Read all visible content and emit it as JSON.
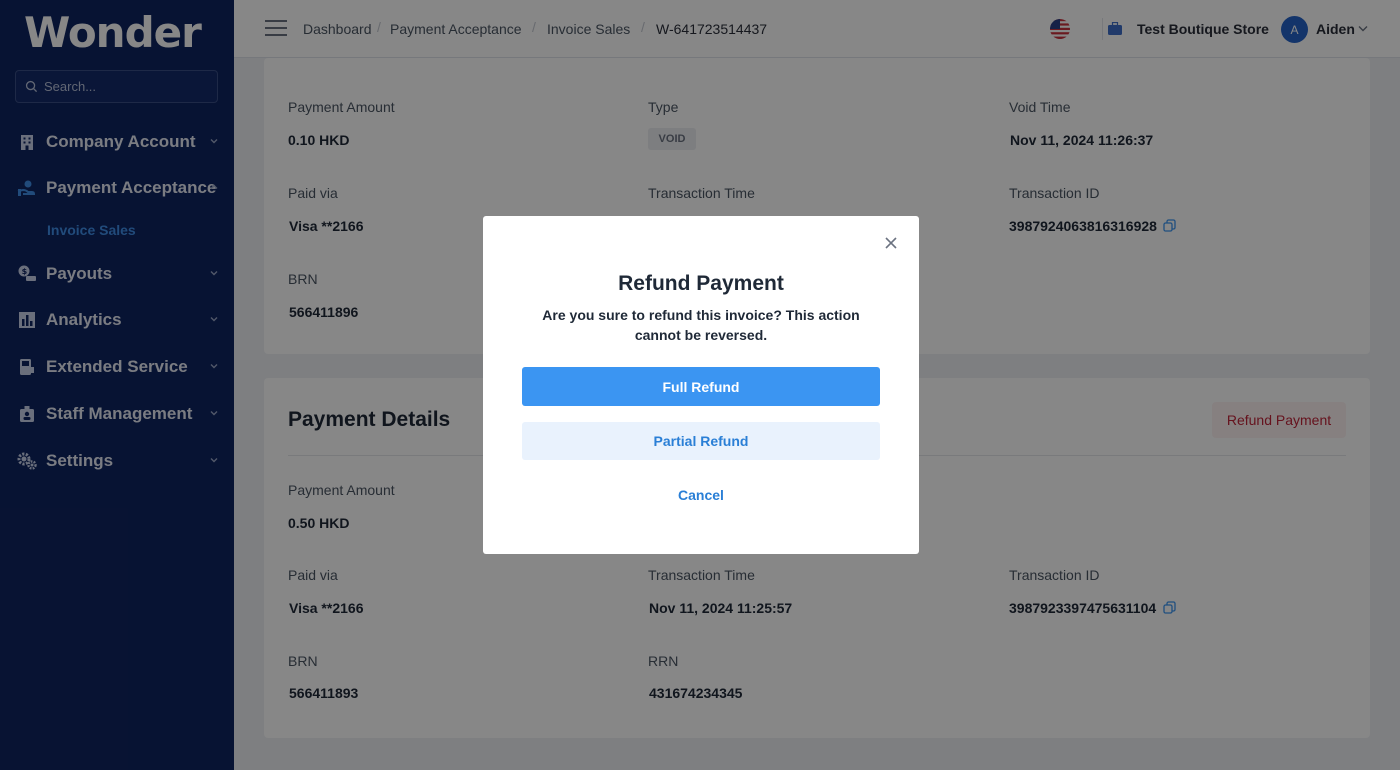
{
  "app": {
    "logo": "Wonder"
  },
  "search": {
    "placeholder": "Search..."
  },
  "sidebar": {
    "items": [
      {
        "label": "Company Account",
        "icon": "building-icon"
      },
      {
        "label": "Payment Acceptance",
        "icon": "hand-payment-icon"
      },
      {
        "label": "Payouts",
        "icon": "coins-icon"
      },
      {
        "label": "Analytics",
        "icon": "bar-chart-icon"
      },
      {
        "label": "Extended Service",
        "icon": "pos-terminal-icon"
      },
      {
        "label": "Staff Management",
        "icon": "staff-badge-icon"
      },
      {
        "label": "Settings",
        "icon": "gears-icon"
      }
    ],
    "sub_item": "Invoice Sales",
    "active_color": "#3f8ee8"
  },
  "header": {
    "breadcrumbs": [
      "Dashboard",
      "Payment Acceptance",
      "Invoice Sales",
      "W-641723514437"
    ],
    "store_name": "Test Boutique Store",
    "avatar_initial": "A",
    "user_name": "Aiden"
  },
  "void_card": {
    "payment_amount_label": "Payment Amount",
    "payment_amount": "0.10 HKD",
    "type_label": "Type",
    "type_value": "VOID",
    "void_time_label": "Void Time",
    "void_time": "Nov 11, 2024 11:26:37",
    "paid_via_label": "Paid via",
    "paid_via": "Visa **2166",
    "transaction_time_label": "Transaction Time",
    "transaction_id_label": "Transaction ID",
    "transaction_id": "3987924063816316928",
    "brn_label": "BRN",
    "brn": "566411896"
  },
  "payment_card": {
    "title": "Payment Details",
    "refund_button": "Refund Payment",
    "payment_amount_label": "Payment Amount",
    "payment_amount": "0.50 HKD",
    "paid_via_label": "Paid via",
    "paid_via": "Visa **2166",
    "transaction_time_label": "Transaction Time",
    "transaction_time": "Nov 11, 2024 11:25:57",
    "transaction_id_label": "Transaction ID",
    "transaction_id": "3987923397475631104",
    "brn_label": "BRN",
    "brn": "566411893",
    "rrn_label": "RRN",
    "rrn": "431674234345"
  },
  "modal": {
    "title": "Refund Payment",
    "message": "Are you sure to refund this invoice? This action cannot be reversed.",
    "full_refund": "Full Refund",
    "partial_refund": "Partial Refund",
    "cancel": "Cancel",
    "primary_color": "#3b95f2"
  }
}
